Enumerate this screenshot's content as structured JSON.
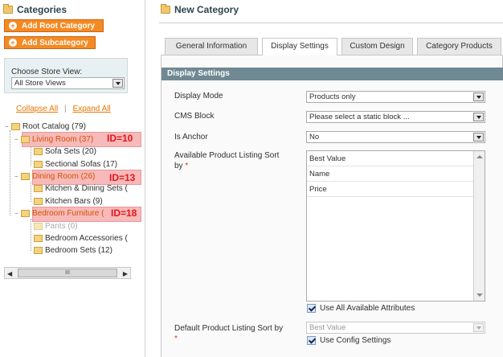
{
  "sidebar": {
    "title": "Categories",
    "add_root_label": "Add Root Category",
    "add_sub_label": "Add Subcategory",
    "store_view": {
      "label": "Choose Store View:",
      "value": "All Store Views"
    },
    "collapse_all": "Collapse All",
    "separator": "|",
    "expand_all": "Expand All",
    "tree": {
      "root": "Root Catalog (79)",
      "living_room": "Living Room (37)",
      "living_id": "ID=10",
      "sofa_sets": "Sofa Sets (20)",
      "sectional_sofas": "Sectional Sofas (17)",
      "dining_room": "Dining Room (26)",
      "dining_id": "ID=13",
      "kitchen_dining_sets": "Kitchen & Dining Sets (",
      "kitchen_bars": "Kitchen Bars (9)",
      "bedroom_furniture": "Bedroom Furniture (",
      "bedroom_id": "ID=18",
      "pants": "Pants (0)",
      "bedroom_accessories": "Bedroom Accessories (",
      "bedroom_sets": "Bedroom Sets (12)"
    },
    "scroll_thumb": "III"
  },
  "main": {
    "title": "New Category",
    "tabs": [
      "General Information",
      "Display Settings",
      "Custom Design",
      "Category Products"
    ],
    "active_tab": "Display Settings",
    "section_title": "Display Settings",
    "fields": {
      "display_mode": {
        "label": "Display Mode",
        "value": "Products only"
      },
      "cms_block": {
        "label": "CMS Block",
        "value": "Please select a static block ..."
      },
      "is_anchor": {
        "label": "Is Anchor",
        "value": "No"
      },
      "sort_by": {
        "label_line1": "Available Product Listing Sort",
        "label_line2": "by",
        "required": "*",
        "options": [
          "Best Value",
          "Name",
          "Price"
        ],
        "use_all_label": "Use All Available Attributes"
      },
      "default_sort": {
        "label": "Default Product Listing Sort by",
        "required": "*",
        "value": "Best Value",
        "use_config_label": "Use Config Settings"
      }
    }
  },
  "colors": {
    "accent": "#f48a22",
    "section_header": "#6f8992",
    "id_label": "#e3161b",
    "highlight": "#f7b9b9"
  }
}
